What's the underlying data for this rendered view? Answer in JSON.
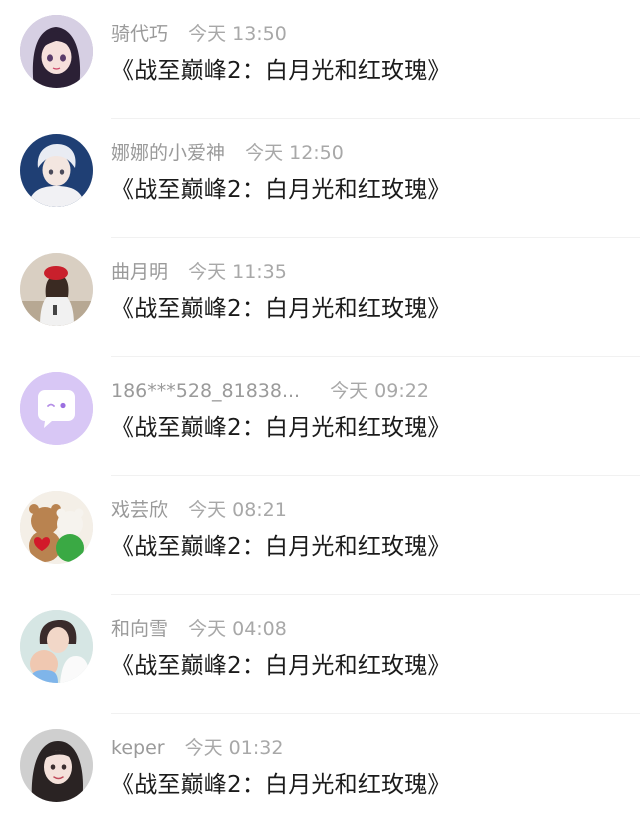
{
  "comments": [
    {
      "name": "骑代巧",
      "time": "今天 13:50",
      "text": "《战至巅峰2：白月光和红玫瑰》",
      "avatar": "avatar-anime-girl-icon"
    },
    {
      "name": "娜娜的小爱神",
      "time": "今天 12:50",
      "text": "《战至巅峰2：白月光和红玫瑰》",
      "avatar": "avatar-white-hair-boy-icon"
    },
    {
      "name": "曲月明",
      "time": "今天 11:35",
      "text": "《战至巅峰2：白月光和红玫瑰》",
      "avatar": "avatar-girl-red-hat-icon"
    },
    {
      "name": "186***528_81838...",
      "time": "今天 09:22",
      "text": "《战至巅峰2：白月光和红玫瑰》",
      "avatar": "avatar-default-chat-icon"
    },
    {
      "name": "戏芸欣",
      "time": "今天 08:21",
      "text": "《战至巅峰2：白月光和红玫瑰》",
      "avatar": "avatar-teddy-bears-icon"
    },
    {
      "name": "和向雪",
      "time": "今天 04:08",
      "text": "《战至巅峰2：白月光和红玫瑰》",
      "avatar": "avatar-mother-baby-icon"
    },
    {
      "name": "keper",
      "time": "今天 01:32",
      "text": "《战至巅峰2：白月光和红玫瑰》",
      "avatar": "avatar-woman-portrait-icon"
    }
  ],
  "colors": {
    "name_text": "#9a9a9a",
    "time_text": "#a8a8a8",
    "message_text": "#1b1b1b",
    "default_avatar_bg": "#d8c7f5",
    "divider": "#f1f1f1"
  }
}
